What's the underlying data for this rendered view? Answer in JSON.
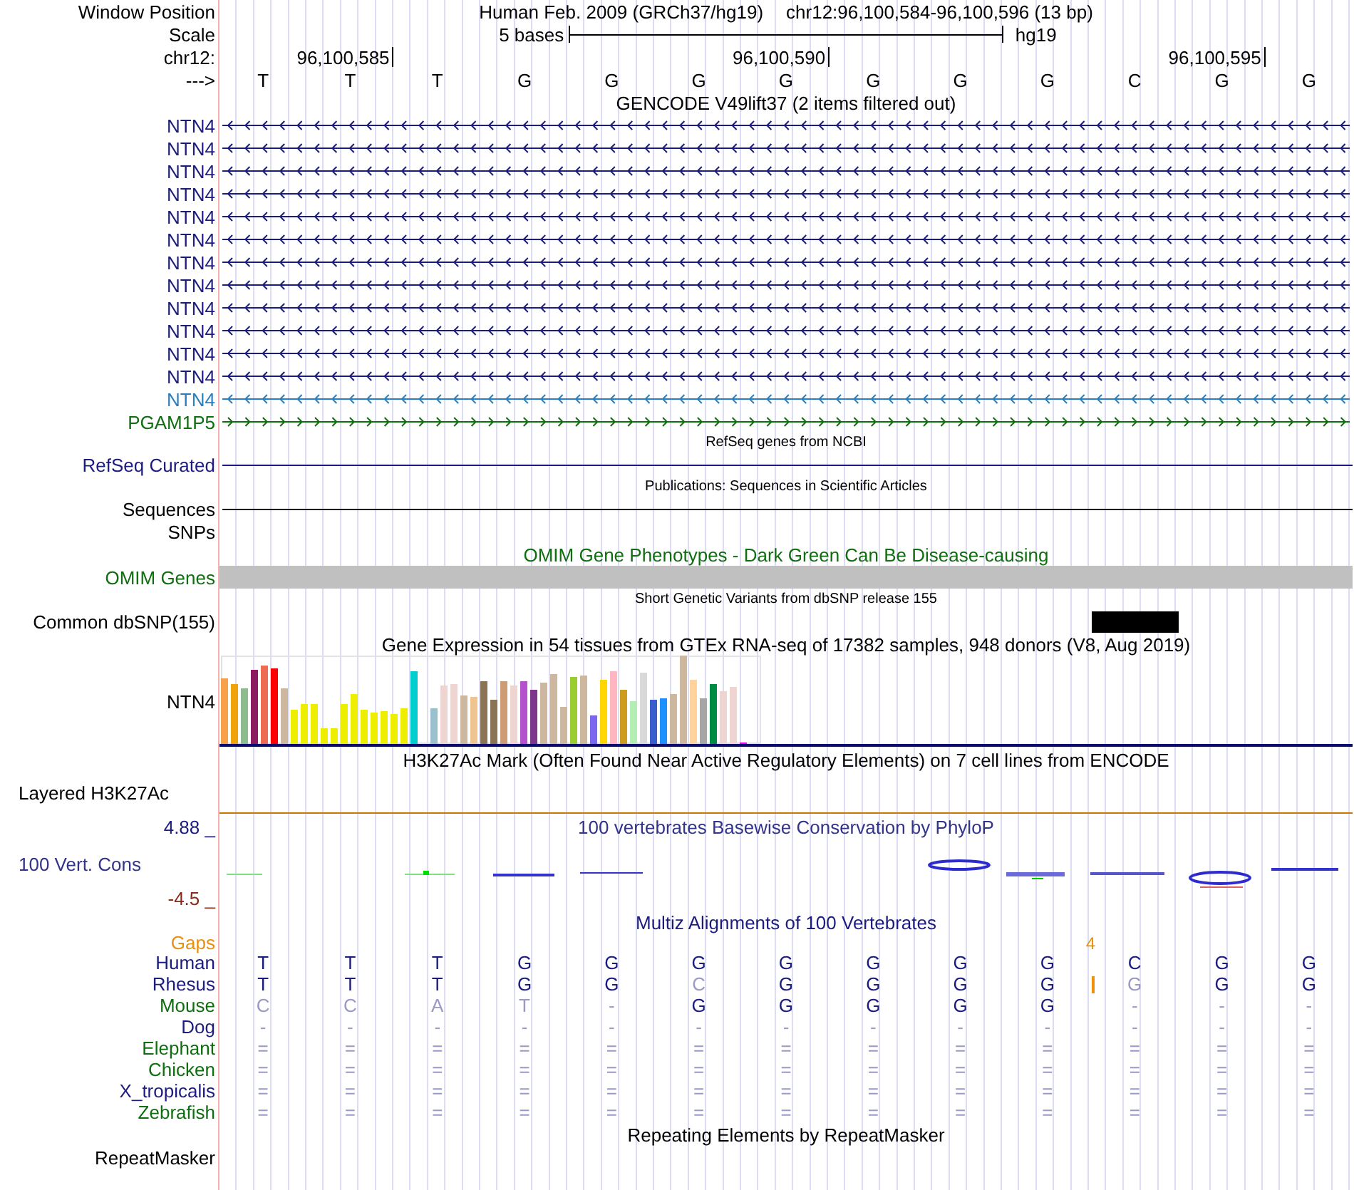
{
  "header": {
    "label": "Window Position",
    "assembly": "Human Feb. 2009 (GRCh37/hg19)",
    "position": "chr12:96,100,584-96,100,596 (13 bp)"
  },
  "scale": {
    "label": "Scale",
    "length": "5 bases",
    "assembly": "hg19"
  },
  "ruler": {
    "label": "chr12:",
    "ticks": [
      "96,100,585",
      "96,100,590",
      "96,100,595"
    ]
  },
  "sequence": {
    "label": "--->",
    "bases": [
      "T",
      "T",
      "T",
      "G",
      "G",
      "G",
      "G",
      "G",
      "G",
      "G",
      "C",
      "G",
      "G"
    ]
  },
  "gencode": {
    "title": "GENCODE V49lift37 (2 items filtered out)",
    "genes": [
      {
        "name": "NTN4",
        "color": "#1c1c80",
        "reverse_strand": true
      },
      {
        "name": "NTN4",
        "color": "#1c1c80",
        "reverse_strand": true
      },
      {
        "name": "NTN4",
        "color": "#1c1c80",
        "reverse_strand": true
      },
      {
        "name": "NTN4",
        "color": "#1c1c80",
        "reverse_strand": true
      },
      {
        "name": "NTN4",
        "color": "#1c1c80",
        "reverse_strand": true
      },
      {
        "name": "NTN4",
        "color": "#1c1c80",
        "reverse_strand": true
      },
      {
        "name": "NTN4",
        "color": "#1c1c80",
        "reverse_strand": true
      },
      {
        "name": "NTN4",
        "color": "#1c1c80",
        "reverse_strand": true
      },
      {
        "name": "NTN4",
        "color": "#1c1c80",
        "reverse_strand": true
      },
      {
        "name": "NTN4",
        "color": "#1c1c80",
        "reverse_strand": true
      },
      {
        "name": "NTN4",
        "color": "#1c1c80",
        "reverse_strand": true
      },
      {
        "name": "NTN4",
        "color": "#1c1c80",
        "reverse_strand": true
      },
      {
        "name": "NTN4",
        "color": "#2a7fbf",
        "reverse_strand": true
      },
      {
        "name": "PGAM1P5",
        "color": "#0f6e0f",
        "reverse_strand": false
      }
    ]
  },
  "refseq": {
    "title": "RefSeq genes from NCBI",
    "label": "RefSeq Curated"
  },
  "publications": {
    "title": "Publications: Sequences in Scientific Articles",
    "label": "Sequences"
  },
  "snps": {
    "label": "SNPs"
  },
  "omim": {
    "title": "OMIM Gene Phenotypes - Dark Green Can Be Disease-causing",
    "label": "OMIM Genes"
  },
  "dbsnp": {
    "title": "Short Genetic Variants from dbSNP release 155",
    "label": "Common dbSNP(155)"
  },
  "gtex": {
    "title": "Gene Expression in 54 tissues from GTEx RNA-seq of 17382 samples, 948 donors (V8, Aug 2019)",
    "label": "NTN4"
  },
  "h3k27ac": {
    "title": "H3K27Ac Mark (Often Found Near Active Regulatory Elements) on 7 cell lines from ENCODE",
    "label": "Layered H3K27Ac"
  },
  "conservation": {
    "title": "100 vertebrates Basewise Conservation by PhyloP",
    "label": "100 Vert. Cons",
    "y_max": "4.88 _",
    "y_min": "-4.5 _"
  },
  "multiz": {
    "title": "Multiz Alignments of 100 Vertebrates",
    "gaps": {
      "label": "Gaps",
      "count": "4"
    },
    "species": [
      {
        "name": "Human",
        "color": "#1c1c80",
        "insertion": false,
        "bases": [
          "T",
          "T",
          "T",
          "G",
          "G",
          "G",
          "G",
          "G",
          "G",
          "G",
          "C",
          "G",
          "G"
        ]
      },
      {
        "name": "Rhesus",
        "color": "#1c1c80",
        "insertion": true,
        "bases": [
          "T",
          "T",
          "T",
          "G",
          "G",
          "C",
          "G",
          "G",
          "G",
          "G",
          "G",
          "G",
          "G"
        ]
      },
      {
        "name": "Mouse",
        "color": "#0f6e0f",
        "insertion": false,
        "bases": [
          "C",
          "C",
          "A",
          "T",
          "-",
          "G",
          "G",
          "G",
          "G",
          "G",
          "-",
          "-",
          "-"
        ]
      },
      {
        "name": "Dog",
        "color": "#1c1c80",
        "insertion": false,
        "bases": [
          "-",
          "-",
          "-",
          "-",
          "-",
          "-",
          "-",
          "-",
          "-",
          "-",
          "-",
          "-",
          "-"
        ]
      },
      {
        "name": "Elephant",
        "color": "#0f6e0f",
        "insertion": false,
        "bases": [
          "=",
          "=",
          "=",
          "=",
          "=",
          "=",
          "=",
          "=",
          "=",
          "=",
          "=",
          "=",
          "="
        ]
      },
      {
        "name": "Chicken",
        "color": "#0f6e0f",
        "insertion": false,
        "bases": [
          "=",
          "=",
          "=",
          "=",
          "=",
          "=",
          "=",
          "=",
          "=",
          "=",
          "=",
          "=",
          "="
        ]
      },
      {
        "name": "X_tropicalis",
        "color": "#1c1c80",
        "insertion": false,
        "bases": [
          "=",
          "=",
          "=",
          "=",
          "=",
          "=",
          "=",
          "=",
          "=",
          "=",
          "=",
          "=",
          "="
        ]
      },
      {
        "name": "Zebrafish",
        "color": "#0f6e0f",
        "insertion": false,
        "bases": [
          "=",
          "=",
          "=",
          "=",
          "=",
          "=",
          "=",
          "=",
          "=",
          "=",
          "=",
          "=",
          "="
        ]
      }
    ]
  },
  "repeatmasker": {
    "title": "Repeating Elements by RepeatMasker",
    "label": "RepeatMasker"
  }
}
